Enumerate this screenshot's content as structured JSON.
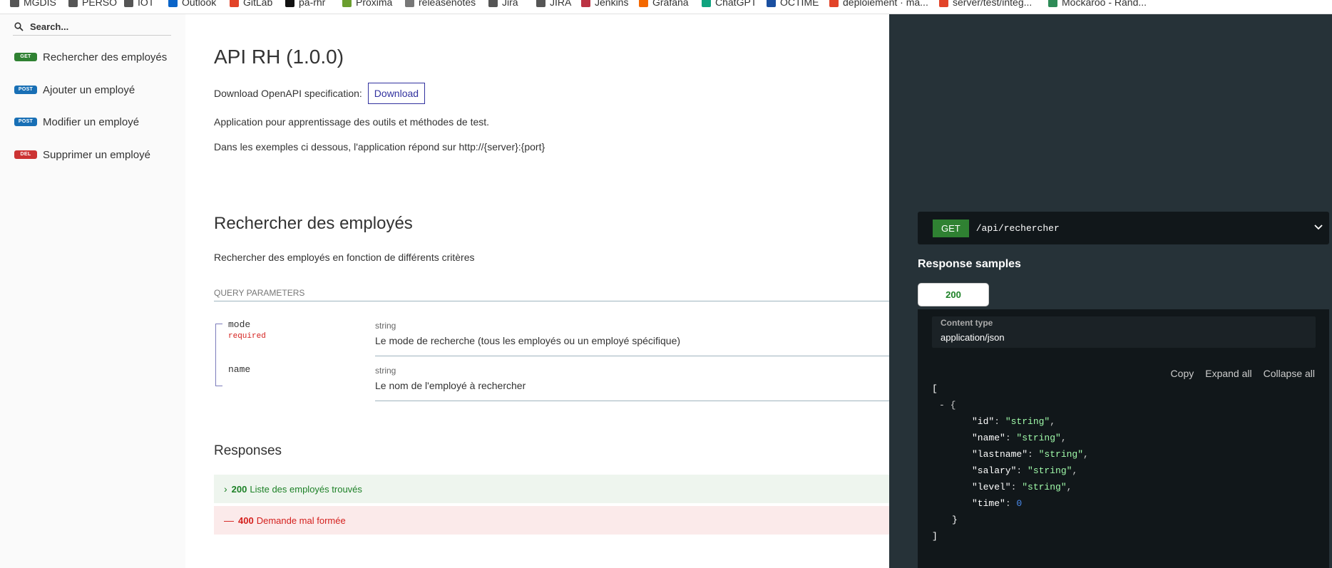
{
  "bookmarks": [
    {
      "label": "MGDIS",
      "color": "#555"
    },
    {
      "label": "PERSO",
      "color": "#555"
    },
    {
      "label": "IOT",
      "color": "#555"
    },
    {
      "label": "Outlook",
      "color": "#0a64c8"
    },
    {
      "label": "GitLab",
      "color": "#e24329"
    },
    {
      "label": "pa-rhr",
      "color": "#111"
    },
    {
      "label": "Proxima",
      "color": "#6b9e2f"
    },
    {
      "label": "releasenotes",
      "color": "#777"
    },
    {
      "label": "Jira",
      "color": "#555"
    },
    {
      "label": "JIRA",
      "color": "#555"
    },
    {
      "label": "Jenkins",
      "color": "#b34"
    },
    {
      "label": "Grafana",
      "color": "#f46800"
    },
    {
      "label": "ChatGPT",
      "color": "#10a37f"
    },
    {
      "label": "OCTIME",
      "color": "#1a4fa0"
    },
    {
      "label": "déploiement · ma...",
      "color": "#e24329"
    },
    {
      "label": "server/test/integ...",
      "color": "#e24329"
    },
    {
      "label": "Mockaroo - Rand...",
      "color": "#2e8b57"
    }
  ],
  "sidebar": {
    "search_placeholder": "Search...",
    "items": [
      {
        "method": "GET",
        "label": "Rechercher des employés"
      },
      {
        "method": "POST",
        "label": "Ajouter un employé"
      },
      {
        "method": "POST",
        "label": "Modifier un employé"
      },
      {
        "method": "DEL",
        "label": "Supprimer un employé"
      }
    ]
  },
  "main": {
    "title": "API RH (1.0.0)",
    "download_label": "Download OpenAPI specification:",
    "download_button": "Download",
    "description1": "Application pour apprentissage des outils et méthodes de test.",
    "description2": "Dans les exemples ci dessous, l'application répond sur http://{server}:{port}",
    "section_title": "Rechercher des employés",
    "section_description": "Rechercher des employés en fonction de différents critères",
    "query_params_header": "QUERY PARAMETERS",
    "params": [
      {
        "name": "mode",
        "required": "required",
        "type": "string",
        "description": "Le mode de recherche (tous les employés ou un employé spécifique)"
      },
      {
        "name": "name",
        "type": "string",
        "description": "Le nom de l'employé à rechercher"
      }
    ],
    "responses_title": "Responses",
    "responses": [
      {
        "icon": "›",
        "code": "200",
        "label": "Liste des employés trouvés"
      },
      {
        "icon": "—",
        "code": "400",
        "label": "Demande mal formée"
      }
    ]
  },
  "right": {
    "method": "GET",
    "path": "/api/rechercher",
    "samples_title": "Response samples",
    "tab": "200",
    "content_type_label": "Content type",
    "content_type_value": "application/json",
    "actions": {
      "copy": "Copy",
      "expand": "Expand all",
      "collapse": "Collapse all"
    },
    "json": {
      "open_bracket": "[",
      "collapse_marker": "- {",
      "fields": [
        {
          "key": "\"id\"",
          "value": "\"string\"",
          "kind": "string",
          "comma": ","
        },
        {
          "key": "\"name\"",
          "value": "\"string\"",
          "kind": "string",
          "comma": ","
        },
        {
          "key": "\"lastname\"",
          "value": "\"string\"",
          "kind": "string",
          "comma": ","
        },
        {
          "key": "\"salary\"",
          "value": "\"string\"",
          "kind": "string",
          "comma": ","
        },
        {
          "key": "\"level\"",
          "value": "\"string\"",
          "kind": "string",
          "comma": ","
        },
        {
          "key": "\"time\"",
          "value": "0",
          "kind": "number",
          "comma": ""
        }
      ],
      "close_brace": "}",
      "close_bracket": "]"
    }
  },
  "colors": {
    "get": "#2f8132",
    "post": "#186fb5",
    "delete": "#cc3333",
    "dark_panel": "#263238"
  }
}
